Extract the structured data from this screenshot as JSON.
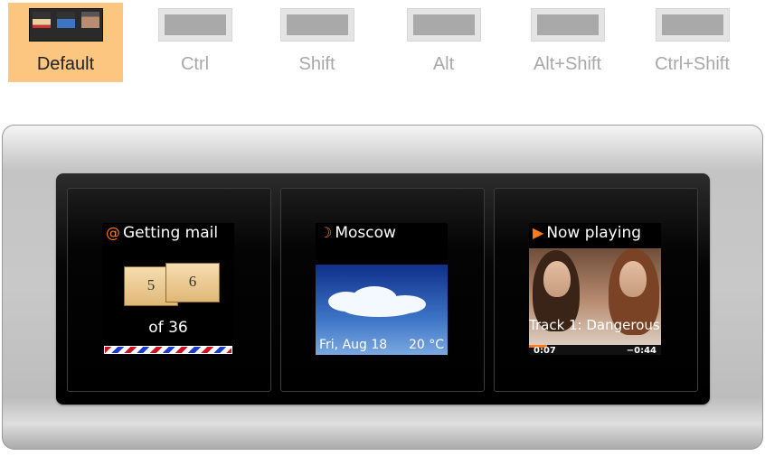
{
  "tabs": [
    {
      "label": "Default",
      "active": true
    },
    {
      "label": "Ctrl",
      "active": false
    },
    {
      "label": "Shift",
      "active": false
    },
    {
      "label": "Alt",
      "active": false
    },
    {
      "label": "Alt+Shift",
      "active": false
    },
    {
      "label": "Ctrl+Shift",
      "active": false
    }
  ],
  "keys": [
    {
      "title": "Getting mail",
      "icon": "at-icon",
      "envelope_back": "5",
      "envelope_front": "6",
      "count_text": "of 36"
    },
    {
      "title": "Moscow",
      "icon": "moon-icon",
      "date": "Fri, Aug 18",
      "temperature": "20 °C"
    },
    {
      "title": "Now playing",
      "icon": "play-icon",
      "track": "Track 1: Dangerous",
      "elapsed": "0:07",
      "remaining": "−0:44",
      "progress": 0.14
    }
  ],
  "colors": {
    "active_tab": "#fdc680",
    "accent": "#ff7a1a",
    "inactive_text": "#a8a8a8"
  }
}
